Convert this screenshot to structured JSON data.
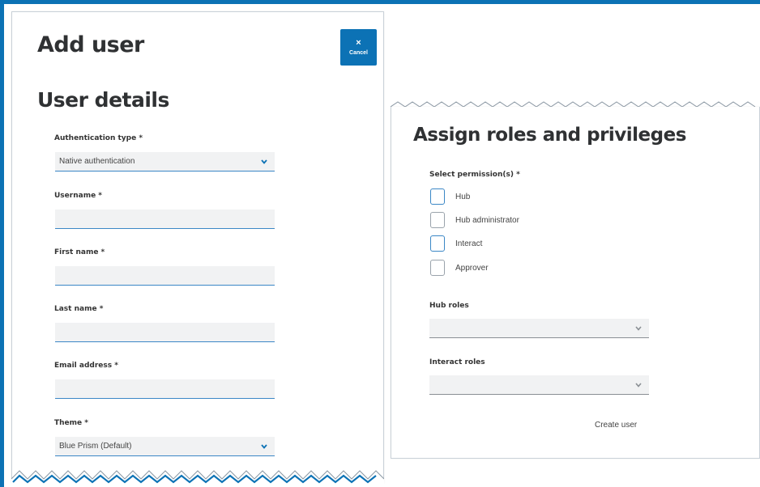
{
  "add_user": {
    "title": "Add user",
    "cancel": {
      "icon": "×",
      "label": "Cancel"
    },
    "section_title": "User details",
    "fields": {
      "auth_type": {
        "label": "Authentication type *",
        "value": "Native authentication"
      },
      "username": {
        "label": "Username *",
        "value": ""
      },
      "first_name": {
        "label": "First name *",
        "value": ""
      },
      "last_name": {
        "label": "Last name *",
        "value": ""
      },
      "email": {
        "label": "Email address *",
        "value": ""
      },
      "theme": {
        "label": "Theme *",
        "value": "Blue Prism (Default)"
      }
    }
  },
  "roles": {
    "title": "Assign roles and privileges",
    "permissions_label": "Select permission(s) *",
    "permissions": [
      {
        "label": "Hub",
        "checked": false
      },
      {
        "label": "Hub administrator",
        "checked": false
      },
      {
        "label": "Interact",
        "checked": false
      },
      {
        "label": "Approver",
        "checked": false
      }
    ],
    "hub_roles": {
      "label": "Hub roles",
      "value": ""
    },
    "interact_roles": {
      "label": "Interact roles",
      "value": ""
    },
    "create_button": "Create user"
  },
  "colors": {
    "accent": "#0c72b5",
    "field_bg": "#f1f2f3",
    "underline": "#3b87c6"
  }
}
